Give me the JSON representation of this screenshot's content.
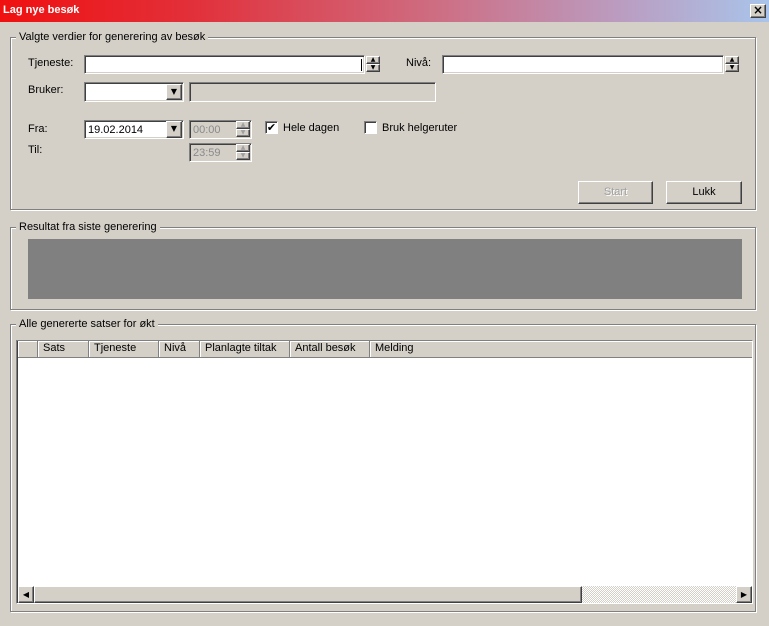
{
  "window": {
    "title": "Lag nye besøk",
    "close_glyph": "×"
  },
  "group_values": {
    "legend": "Valgte verdier for generering av besøk",
    "tjeneste_label": "Tjeneste:",
    "tjeneste_value": "",
    "niva_label": "Nivå:",
    "niva_value": "",
    "bruker_label": "Bruker:",
    "bruker_value": "",
    "bruker_name": "",
    "fra_label": "Fra:",
    "fra_date": "19.02.2014",
    "fra_time": "00:00",
    "til_label": "Til:",
    "til_time": "23:59",
    "hele_dagen_label": "Hele dagen",
    "hele_dagen_checked": true,
    "bruk_helgeruter_label": "Bruk helgeruter",
    "bruk_helgeruter_checked": false,
    "start_label": "Start",
    "lukk_label": "Lukk"
  },
  "group_result": {
    "legend": "Resultat fra siste generering"
  },
  "group_sets": {
    "legend": "Alle genererte satser for økt",
    "columns": [
      "Sats",
      "Tjeneste",
      "Nivå",
      "Planlagte tiltak",
      "Antall besøk",
      "Melding"
    ],
    "rows": []
  },
  "icons": {
    "spin_up": "▲",
    "spin_down": "▼",
    "dropdown": "▼",
    "check": "✔",
    "scroll_left": "◀",
    "scroll_right": "▶"
  }
}
